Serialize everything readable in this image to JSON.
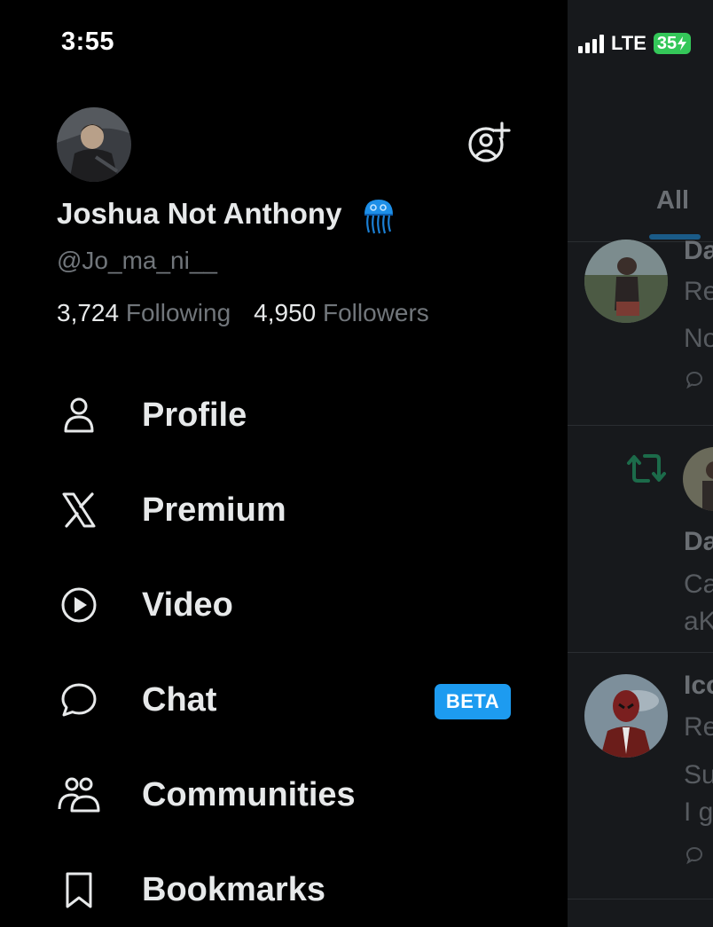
{
  "status_bar": {
    "time": "3:55",
    "network": "LTE",
    "battery": "35"
  },
  "profile": {
    "display_name": "Joshua Not Anthony",
    "handle": "@Jo_ma_ni__",
    "following_count": "3,724",
    "following_label": "Following",
    "followers_count": "4,950",
    "followers_label": "Followers",
    "name_emoji": "jellyfish-emoji"
  },
  "menu": {
    "items": [
      {
        "label": "Profile",
        "icon": "person-icon"
      },
      {
        "label": "Premium",
        "icon": "x-logo-icon"
      },
      {
        "label": "Video",
        "icon": "play-circle-icon"
      },
      {
        "label": "Chat",
        "icon": "chat-bubble-icon",
        "badge": "BETA"
      },
      {
        "label": "Communities",
        "icon": "communities-icon"
      },
      {
        "label": "Bookmarks",
        "icon": "bookmark-icon"
      }
    ]
  },
  "background_feed": {
    "tab_label": "All",
    "fragments": {
      "row1_name": "Da",
      "row1_line2": "Re",
      "row1_line3": "No",
      "row2_name": "Da",
      "row2_line2": "Ca",
      "row2_line3": "aK",
      "row3_name": "Ico",
      "row3_line2": "Re",
      "row3_line3": "Su",
      "row3_line4": "I g"
    }
  },
  "colors": {
    "background": "#000000",
    "accent": "#1d9bf0",
    "text_primary": "#e7e9ea",
    "text_secondary": "#71767b",
    "retweet_green": "#1c6b4a"
  }
}
